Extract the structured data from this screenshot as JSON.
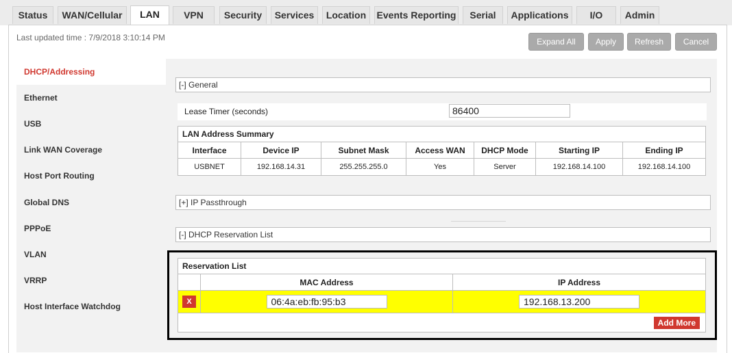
{
  "tabs": [
    {
      "label": "Status"
    },
    {
      "label": "WAN/Cellular"
    },
    {
      "label": "LAN"
    },
    {
      "label": "VPN"
    },
    {
      "label": "Security"
    },
    {
      "label": "Services"
    },
    {
      "label": "Location"
    },
    {
      "label": "Events Reporting"
    },
    {
      "label": "Serial"
    },
    {
      "label": "Applications"
    },
    {
      "label": "I/O"
    },
    {
      "label": "Admin"
    }
  ],
  "active_tab": "LAN",
  "last_updated": "Last updated time : 7/9/2018 3:10:14 PM",
  "toolbar": {
    "expand_all": "Expand All",
    "apply": "Apply",
    "refresh": "Refresh",
    "cancel": "Cancel"
  },
  "sidebar": {
    "items": [
      {
        "label": "DHCP/Addressing"
      },
      {
        "label": "Ethernet"
      },
      {
        "label": "USB"
      },
      {
        "label": "Link WAN Coverage"
      },
      {
        "label": "Host Port Routing"
      },
      {
        "label": "Global DNS"
      },
      {
        "label": "PPPoE"
      },
      {
        "label": "VLAN"
      },
      {
        "label": "VRRP"
      },
      {
        "label": "Host Interface Watchdog"
      }
    ]
  },
  "general": {
    "header": "[-] General",
    "lease_label": "Lease Timer (seconds)",
    "lease_value": "86400"
  },
  "summary": {
    "title": "LAN Address Summary",
    "columns": [
      "Interface",
      "Device IP",
      "Subnet Mask",
      "Access WAN",
      "DHCP Mode",
      "Starting IP",
      "Ending IP"
    ],
    "row": [
      "USBNET",
      "192.168.14.31",
      "255.255.255.0",
      "Yes",
      "Server",
      "192.168.14.100",
      "192.168.14.100"
    ]
  },
  "ip_passthrough": {
    "header": "[+] IP Passthrough"
  },
  "dhcp_reservation": {
    "header": "[-] DHCP Reservation List",
    "list_title": "Reservation List",
    "col_mac": "MAC Address",
    "col_ip": "IP Address",
    "delete_label": "X",
    "mac_value": "06:4a:eb:fb:95:b3",
    "ip_value": "192.168.13.200",
    "add_more": "Add More"
  },
  "colors": {
    "accent_red": "#d0382f",
    "highlight_yellow": "#ffff00"
  }
}
